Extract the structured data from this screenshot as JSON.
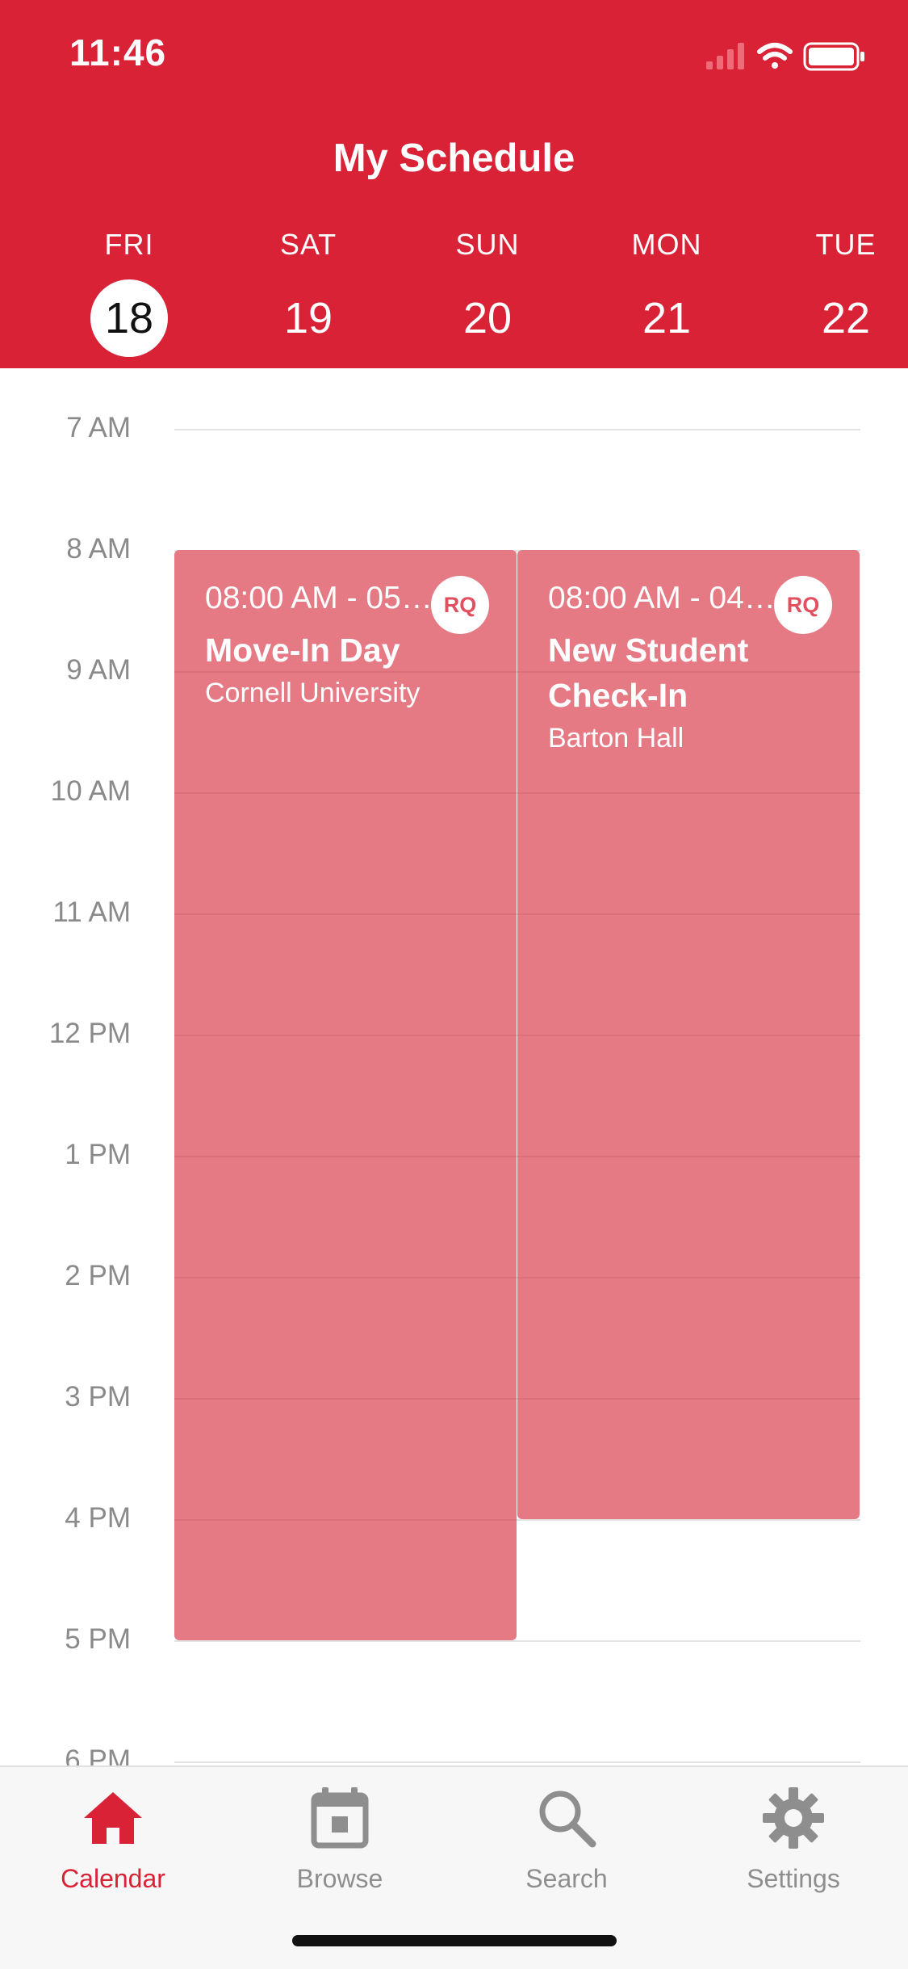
{
  "status": {
    "time": "11:46"
  },
  "header": {
    "title": "My Schedule",
    "days": [
      {
        "name": "FRI",
        "num": "18",
        "selected": true
      },
      {
        "name": "SAT",
        "num": "19",
        "selected": false
      },
      {
        "name": "SUN",
        "num": "20",
        "selected": false
      },
      {
        "name": "MON",
        "num": "21",
        "selected": false
      },
      {
        "name": "TUE",
        "num": "22",
        "selected": false
      }
    ]
  },
  "timeline": {
    "hours": [
      "7 AM",
      "8 AM",
      "9 AM",
      "10 AM",
      "11 AM",
      "12 PM",
      "1 PM",
      "2 PM",
      "3 PM",
      "4 PM",
      "5 PM",
      "6 PM"
    ]
  },
  "events": [
    {
      "time": "08:00 AM - 05…",
      "title": "Move-In Day",
      "location": "Cornell University",
      "badge": "RQ"
    },
    {
      "time": "08:00 AM - 04…",
      "title_line1": "New Student",
      "title_line2": "Check-In",
      "location": "Barton Hall",
      "badge": "RQ"
    }
  ],
  "tabs": [
    {
      "label": "Calendar",
      "icon": "home-icon",
      "active": true
    },
    {
      "label": "Browse",
      "icon": "calendar-icon",
      "active": false
    },
    {
      "label": "Search",
      "icon": "search-icon",
      "active": false
    },
    {
      "label": "Settings",
      "icon": "gear-icon",
      "active": false
    }
  ],
  "colors": {
    "accent": "#d92236",
    "event": "#e67a84"
  }
}
